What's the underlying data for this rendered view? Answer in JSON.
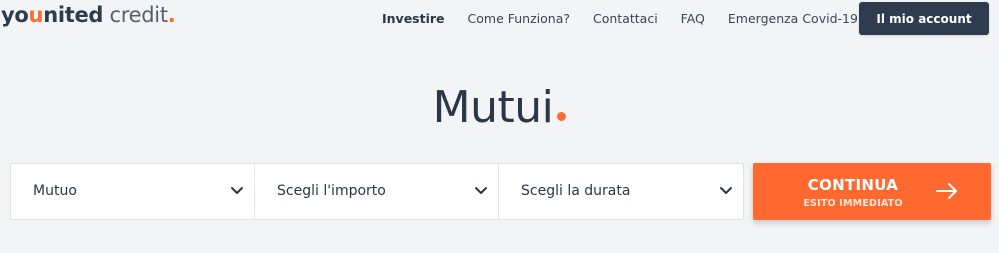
{
  "logo": {
    "part1": "yo",
    "part2": "u",
    "part3": "nited",
    "part4": " credit",
    "part5": "."
  },
  "nav": {
    "items": [
      {
        "label": "Investire",
        "active": true
      },
      {
        "label": "Come Funziona?"
      },
      {
        "label": "Contattaci"
      },
      {
        "label": "FAQ"
      },
      {
        "label": "Emergenza Covid-19"
      }
    ],
    "account_button": "Il mio account"
  },
  "hero": {
    "title": "Mutui"
  },
  "form": {
    "product": {
      "value": "Mutuo",
      "icon": "chevron-down-icon"
    },
    "amount": {
      "value": "Scegli l'importo",
      "icon": "chevron-down-icon"
    },
    "duration": {
      "value": "Scegli la durata",
      "icon": "chevron-down-icon"
    }
  },
  "cta": {
    "label": "CONTINUA",
    "sublabel": "ESITO IMMEDIATO",
    "icon": "arrow-right-icon"
  },
  "colors": {
    "accent": "#ff6930",
    "dark": "#2f3b4f",
    "background": "#f3f4f6"
  }
}
